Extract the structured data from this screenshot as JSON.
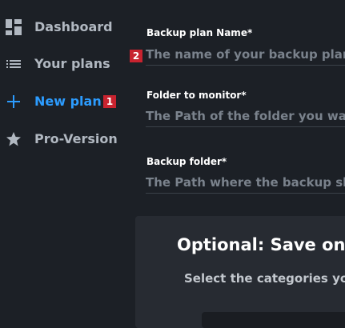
{
  "sidebar": {
    "items": [
      {
        "label": "Dashboard",
        "icon": "dashboard-icon",
        "active": false
      },
      {
        "label": "Your plans",
        "icon": "list-icon",
        "active": false
      },
      {
        "label": "New plan",
        "icon": "plus-icon",
        "active": true,
        "badge": "1"
      },
      {
        "label": "Pro-Version",
        "icon": "star-icon",
        "active": false
      }
    ]
  },
  "form": {
    "plan_name": {
      "label": "Backup plan Name*",
      "placeholder": "The name of your backup plan",
      "badge": "2"
    },
    "folder_to_monitor": {
      "label": "Folder to monitor*",
      "placeholder": "The Path of the folder you want to monitor"
    },
    "backup_folder": {
      "label": "Backup folder*",
      "placeholder": "The Path where the backup should be stored"
    }
  },
  "optional_section": {
    "title": "Optional: Save on",
    "subtitle": "Select the categories you"
  },
  "colors": {
    "background": "#1c2026",
    "accent": "#2c9cff",
    "badge": "#c8232f",
    "card": "#272b32"
  }
}
